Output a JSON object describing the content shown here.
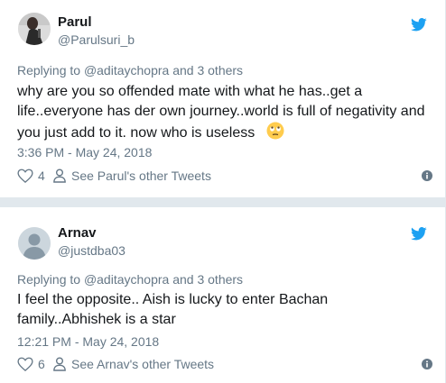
{
  "tweets": [
    {
      "name": "Parul",
      "handle": "@Parulsuri_b",
      "replying_prefix": "Replying to ",
      "replying_user": "@aditaychopra",
      "replying_suffix": " and 3 others",
      "text_line1": "why are you so offended mate with what he has..get a",
      "text_line2": "life..everyone has der own journey..world is full of negativity and",
      "text_line3": "you just add to it. now who is useless",
      "emoji": "face-with-rolling-eyes",
      "timestamp": "3:36 PM - May 24, 2018",
      "likes": "4",
      "other_tweets_label": "See Parul's other Tweets"
    },
    {
      "name": "Arnav",
      "handle": "@justdba03",
      "replying_prefix": "Replying to ",
      "replying_user": "@aditaychopra",
      "replying_suffix": " and 3 others",
      "text_line1": "I feel the opposite.. Aish is lucky to enter Bachan",
      "text_line2": "family..Abhishek is a star",
      "timestamp": "12:21 PM - May 24, 2018",
      "likes": "6",
      "other_tweets_label": "See Arnav's other Tweets"
    }
  ],
  "colors": {
    "twitter_blue": "#1da1f2",
    "secondary_text": "#657786",
    "primary_text": "#14171a"
  },
  "icons": [
    "twitter-bird-icon",
    "heart-icon",
    "person-icon",
    "info-icon",
    "default-avatar-icon"
  ]
}
